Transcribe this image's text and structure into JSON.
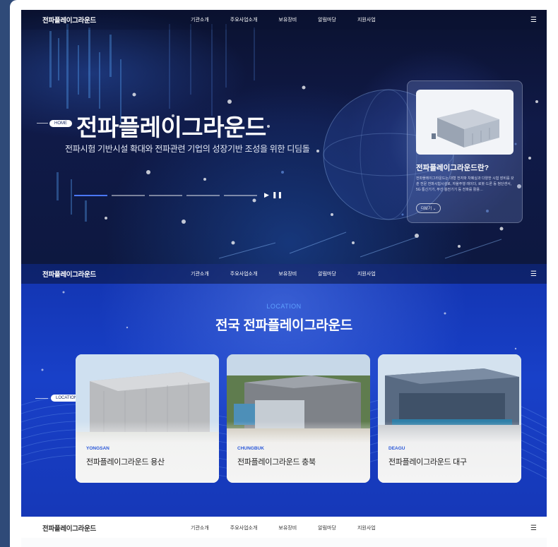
{
  "header": {
    "logo": "전파플레이그라운드",
    "nav": [
      "기관소개",
      "주요사업소개",
      "보유장비",
      "알림마당",
      "지원사업"
    ],
    "menu_icon": "hamburger-icon"
  },
  "hero": {
    "badge": "HOME",
    "title": "전파플레이그라운드",
    "subtitle": "전파시험 기반시설 확대와 전파관련 기업의 성장기반 조성을 위한 디딤돌",
    "controls": {
      "play": "▶",
      "pause": "❚❚"
    },
    "card": {
      "title": "전파플레이그라운드란?",
      "desc": "전파플레이그라운드는 대형 전자파 차폐실과 다양한 시험 장비를 갖춘 전문 전파시험시설로, 자율주행 레이더, 로봇·드론 등 첨단센서, 5G 통신기기, 무선 충전기기 등 전파를 활용…",
      "more": "더보기 ⌄"
    }
  },
  "location": {
    "badge": "LOCATION",
    "label": "LOCATION",
    "title": "전국 전파플레이그라운드",
    "sites": [
      {
        "en": "YONGSAN",
        "ko": "전파플레이그라운드 용산"
      },
      {
        "en": "CHUNGBUK",
        "ko": "전파플레이그라운드 충북"
      },
      {
        "en": "DEAGU",
        "ko": "전파플레이그라운드 대구"
      }
    ]
  },
  "colors": {
    "accent": "#4a78ff",
    "location_bg": "#1840c8",
    "dark_bg": "#0b1330"
  }
}
